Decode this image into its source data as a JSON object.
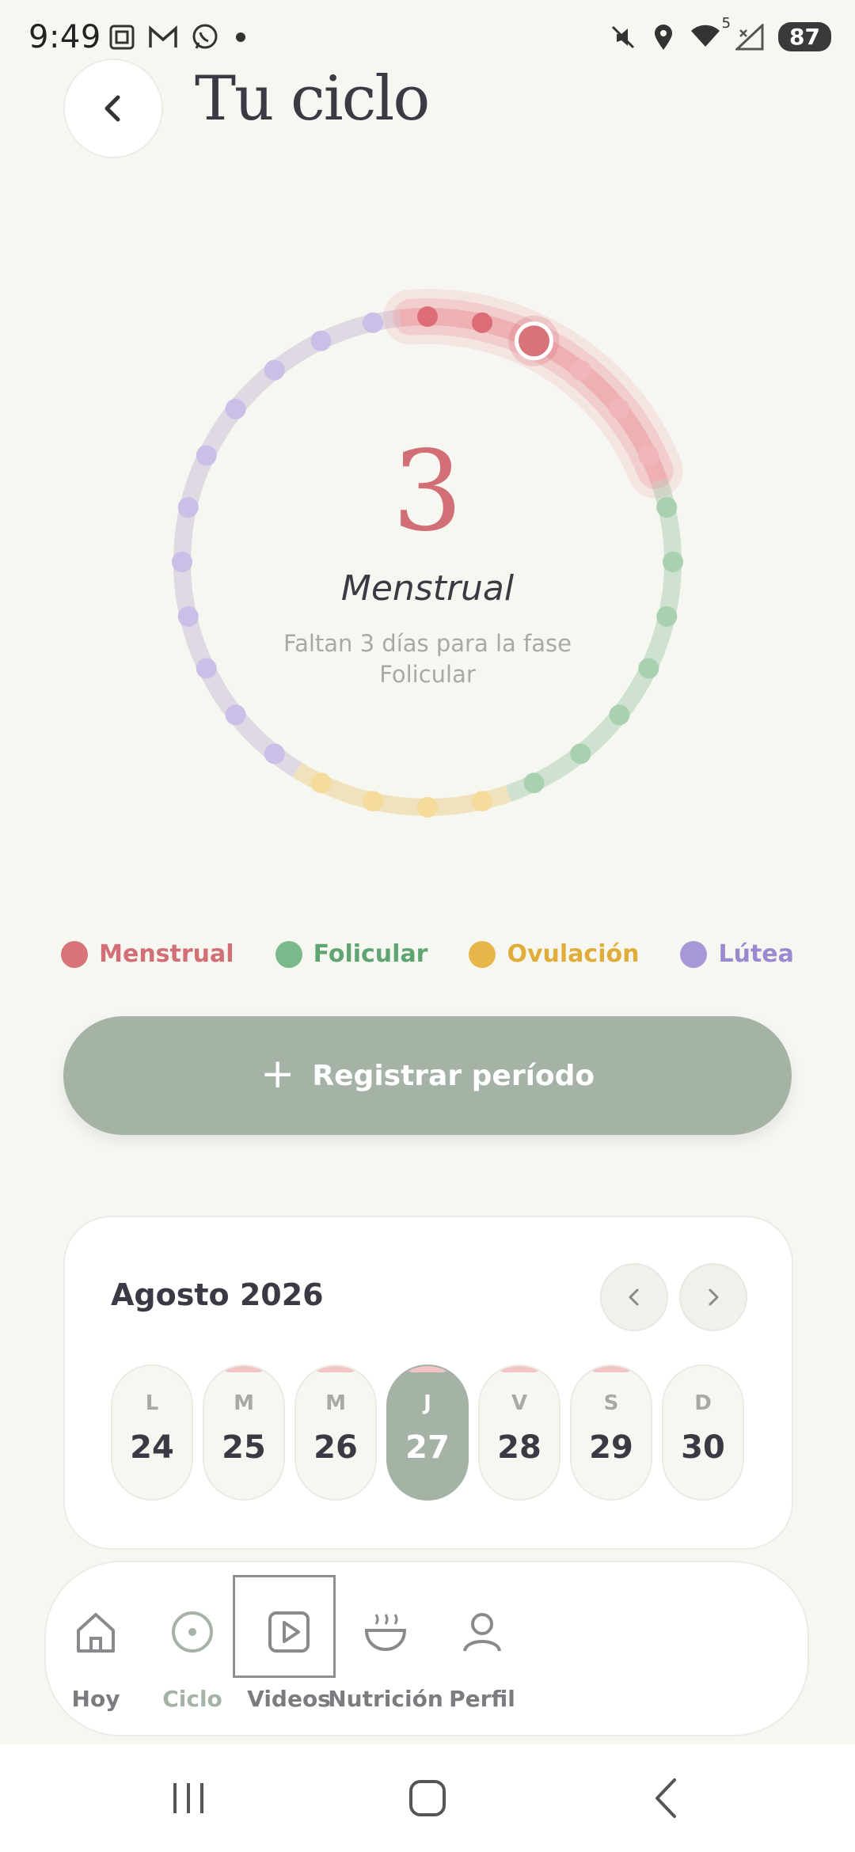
{
  "status_bar": {
    "time": "9:49",
    "left_icons": [
      "screenshot-icon",
      "gmail-icon",
      "whatsapp-icon",
      "dot-icon"
    ],
    "right_icons": [
      "mute-icon",
      "location-icon",
      "wifi-icon",
      "signal-icon"
    ],
    "wifi_badge": "5",
    "battery": "87"
  },
  "header": {
    "title": "Tu ciclo",
    "back_icon": "chevron-left-icon"
  },
  "cycle": {
    "current_day": "3",
    "phase": "Menstrual",
    "subtitle": "Faltan 3 días para la fase Folicular",
    "total_days": 28,
    "current_index": 3,
    "days": [
      "menstrual",
      "menstrual",
      "menstrual",
      "menstrual",
      "menstrual",
      "menstrual",
      "folicular",
      "folicular",
      "folicular",
      "folicular",
      "folicular",
      "folicular",
      "folicular",
      "ovulacion",
      "ovulacion",
      "ovulacion",
      "ovulacion",
      "lutea",
      "lutea",
      "lutea",
      "lutea",
      "lutea",
      "lutea",
      "lutea",
      "lutea",
      "lutea",
      "lutea",
      "lutea"
    ]
  },
  "phase_colors": {
    "menstrual": "#d9737a",
    "folicular": "#79b98a",
    "ovulacion": "#e6b64a",
    "lutea": "#a898d8"
  },
  "legend": [
    {
      "label": "Menstrual",
      "key": "menstrual",
      "text_color": "#d26f76"
    },
    {
      "label": "Folicular",
      "key": "folicular",
      "text_color": "#5fa573"
    },
    {
      "label": "Ovulación",
      "key": "ovulacion",
      "text_color": "#e1ad3a"
    },
    {
      "label": "Lútea",
      "key": "lutea",
      "text_color": "#9a89cf"
    }
  ],
  "register_button": {
    "label": "Registrar período",
    "icon": "plus-icon"
  },
  "calendar": {
    "title": "Agosto 2026",
    "prev_icon": "chevron-left-icon",
    "next_icon": "chevron-right-icon",
    "days": [
      {
        "letter": "L",
        "number": "24",
        "period": false,
        "selected": false
      },
      {
        "letter": "M",
        "number": "25",
        "period": true,
        "selected": false
      },
      {
        "letter": "M",
        "number": "26",
        "period": true,
        "selected": false
      },
      {
        "letter": "J",
        "number": "27",
        "period": true,
        "selected": true
      },
      {
        "letter": "V",
        "number": "28",
        "period": true,
        "selected": false
      },
      {
        "letter": "S",
        "number": "29",
        "period": true,
        "selected": false
      },
      {
        "letter": "D",
        "number": "30",
        "period": false,
        "selected": false
      }
    ]
  },
  "bottom_nav": {
    "items": [
      {
        "label": "Hoy",
        "icon": "home-icon",
        "active": false
      },
      {
        "label": "Ciclo",
        "icon": "cycle-icon",
        "active": true
      },
      {
        "label": "Videos",
        "icon": "video-icon",
        "active": false
      },
      {
        "label": "Nutrición",
        "icon": "bowl-icon",
        "active": false
      },
      {
        "label": "Perfil",
        "icon": "profile-icon",
        "active": false
      }
    ]
  },
  "system_nav": [
    "recents-icon",
    "home-button-icon",
    "back-icon"
  ]
}
